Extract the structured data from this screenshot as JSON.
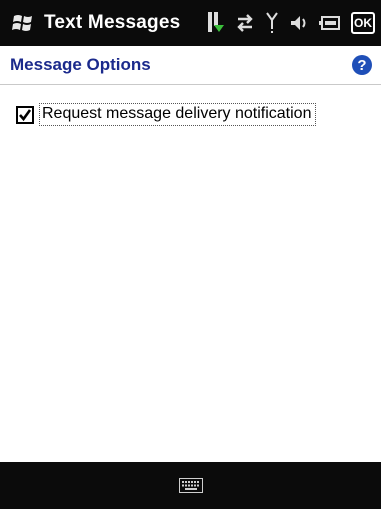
{
  "title_bar": {
    "app_title": "Text Messages",
    "icons": [
      "windows-start-icon",
      "notification-icon",
      "connectivity-icon",
      "signal-icon",
      "volume-icon",
      "battery-icon"
    ],
    "ok_label": "OK"
  },
  "header": {
    "page_title": "Message Options",
    "help_icon": "help-icon"
  },
  "options": {
    "delivery_notification": {
      "label": "Request message delivery notification",
      "checked": true
    }
  },
  "soft_keys": {
    "input_icon": "keyboard-icon"
  },
  "colors": {
    "title_bar_bg": "#0b0b0b",
    "header_text": "#1b2a8c",
    "help_icon": "#1f4fb8"
  }
}
